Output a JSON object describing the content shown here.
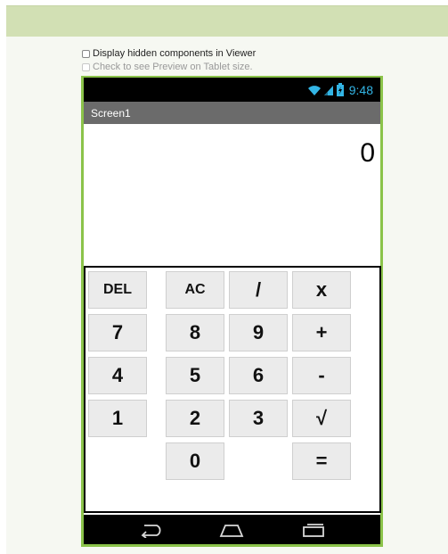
{
  "designer": {
    "show_hidden_label": "Display hidden components in Viewer",
    "tablet_preview_label": "Check to see Preview on Tablet size."
  },
  "status_bar": {
    "time": "9:48",
    "icons": [
      "wifi-icon",
      "signal-icon",
      "battery-icon"
    ],
    "time_color": "#33b5e5"
  },
  "screen": {
    "title": "Screen1"
  },
  "calculator": {
    "display": "0",
    "keys": [
      "DEL",
      "AC",
      "/",
      "x",
      "7",
      "8",
      "9",
      "+",
      "4",
      "5",
      "6",
      "-",
      "1",
      "2",
      "3",
      "√",
      "0",
      "="
    ]
  },
  "nav_bar": {
    "icons": [
      "back-icon",
      "home-icon",
      "recent-apps-icon"
    ]
  },
  "colors": {
    "top_bar": "#d2e0b4",
    "phone_frame": "#8bc34a",
    "title_bar": "#6b6b6b",
    "key_face": "#ebebeb"
  }
}
